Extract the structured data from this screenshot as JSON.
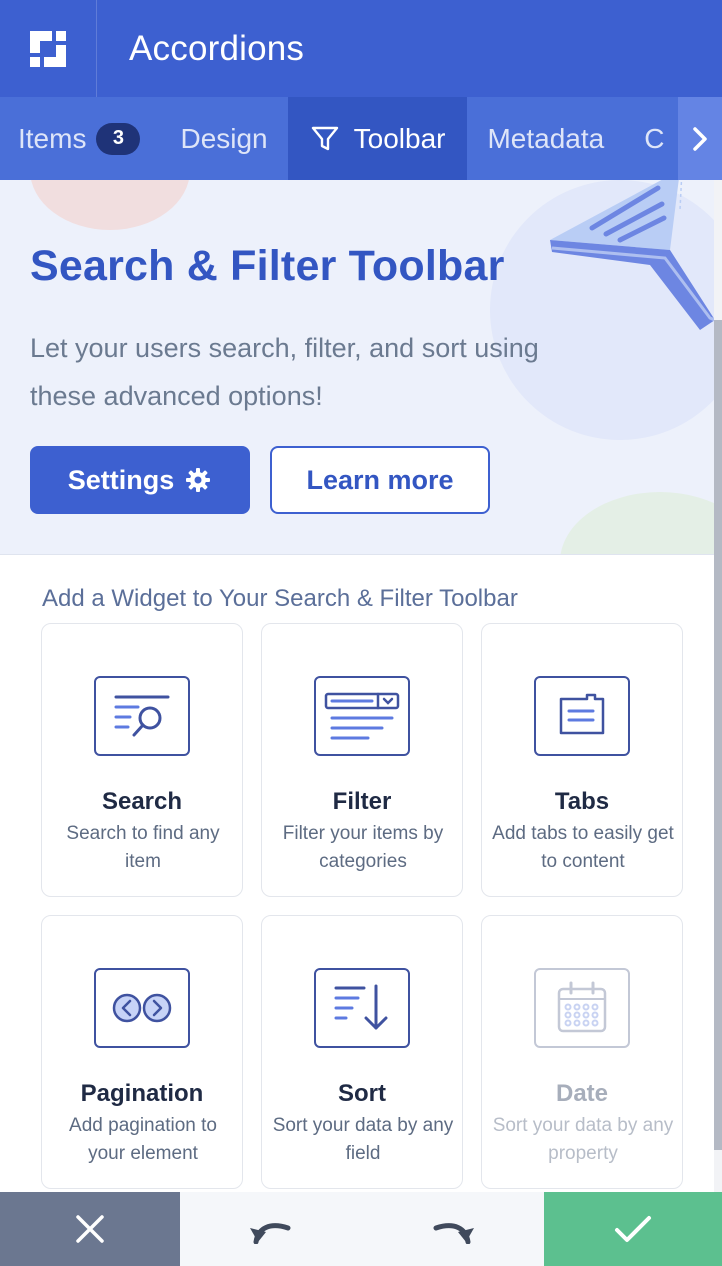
{
  "app": {
    "title": "Accordions",
    "logo_icon": "builder-logo-icon"
  },
  "tabs": [
    {
      "label": "Items",
      "badge": "3"
    },
    {
      "label": "Design"
    },
    {
      "label": "Toolbar",
      "icon": "filter-icon",
      "active": true
    },
    {
      "label": "Metadata"
    },
    {
      "label": "C"
    }
  ],
  "hero": {
    "title": "Search & Filter Toolbar",
    "description": "Let your users search, filter, and sort using these advanced options!",
    "settings_label": "Settings",
    "learn_more_label": "Learn more"
  },
  "widgets": {
    "section_title": "Add a Widget to Your Search & Filter Toolbar",
    "items": [
      {
        "title": "Search",
        "desc": "Search to find any item",
        "icon": "search-widget-icon",
        "enabled": true
      },
      {
        "title": "Filter",
        "desc": "Filter your items by categories",
        "icon": "filter-widget-icon",
        "enabled": true
      },
      {
        "title": "Tabs",
        "desc": "Add tabs to easily get to content",
        "icon": "tabs-widget-icon",
        "enabled": true
      },
      {
        "title": "Pagination",
        "desc": "Add pagination to your element",
        "icon": "pagination-widget-icon",
        "enabled": true
      },
      {
        "title": "Sort",
        "desc": "Sort your data by any field",
        "icon": "sort-widget-icon",
        "enabled": true
      },
      {
        "title": "Date",
        "desc": "Sort your data by any property",
        "icon": "date-widget-icon",
        "enabled": false
      }
    ]
  },
  "colors": {
    "primary": "#3d60d0",
    "tab_bar": "#4a6fd8",
    "active_tab": "#3356c2",
    "cancel": "#6b7790",
    "save": "#5cc08f"
  },
  "bottom_bar": {
    "cancel_icon": "close-icon",
    "undo_icon": "undo-icon",
    "redo_icon": "redo-icon",
    "save_icon": "check-icon"
  }
}
